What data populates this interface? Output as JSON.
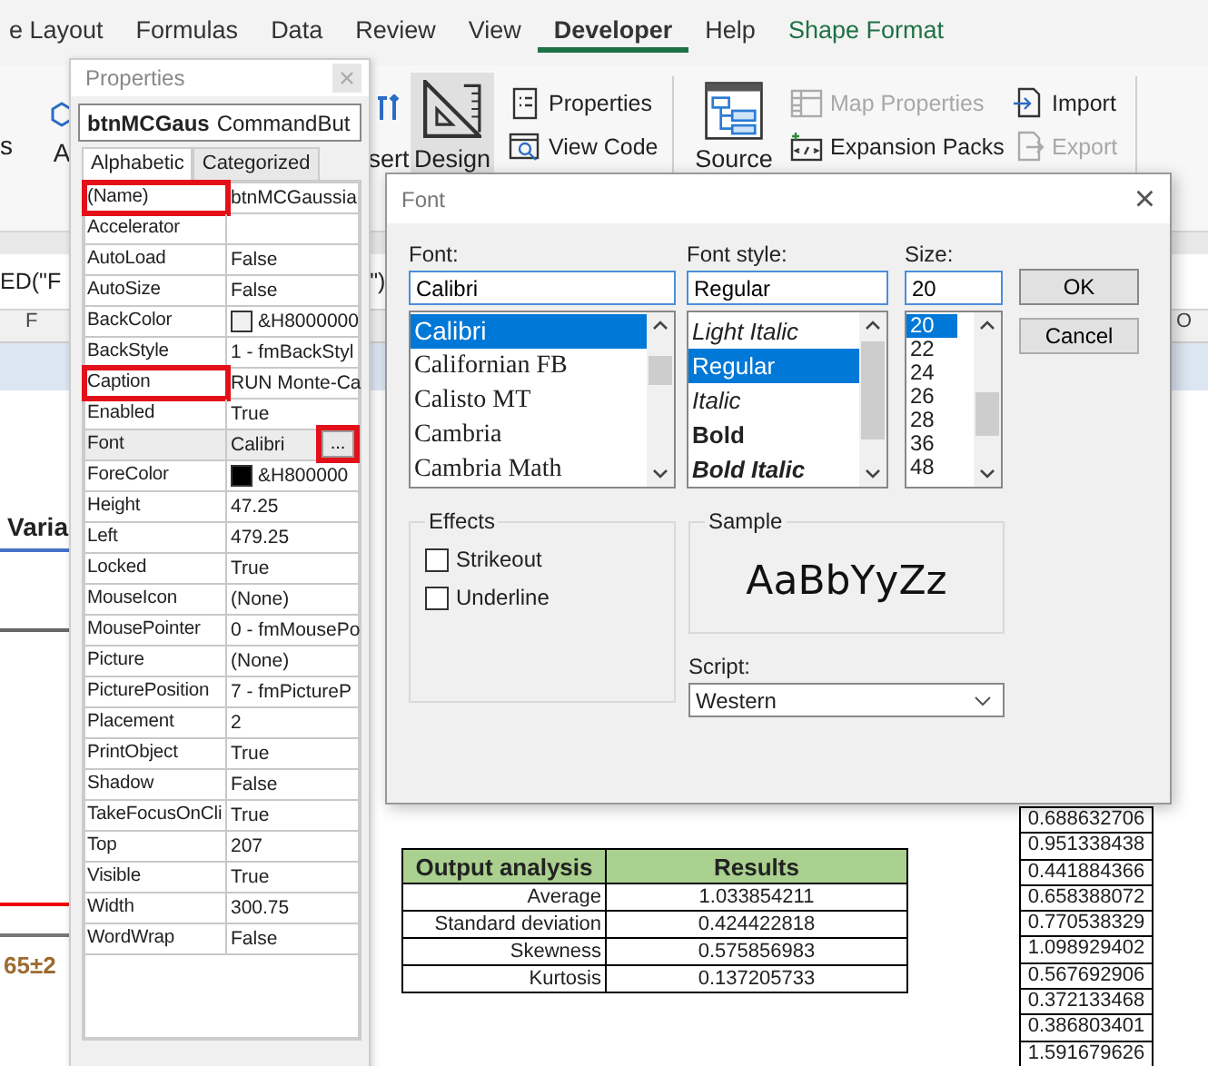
{
  "ribbon": {
    "tabs": [
      {
        "label": "e Layout",
        "selected": false,
        "kind": "normal"
      },
      {
        "label": "Formulas",
        "selected": false,
        "kind": "normal"
      },
      {
        "label": "Data",
        "selected": false,
        "kind": "normal"
      },
      {
        "label": "Review",
        "selected": false,
        "kind": "normal"
      },
      {
        "label": "View",
        "selected": false,
        "kind": "normal"
      },
      {
        "label": "Developer",
        "selected": true,
        "kind": "normal"
      },
      {
        "label": "Help",
        "selected": false,
        "kind": "normal"
      },
      {
        "label": "Shape Format",
        "selected": false,
        "kind": "contextual"
      }
    ],
    "edge_text": "s",
    "addins_text": "A",
    "groups": [
      {
        "large": [
          {
            "label": "sert",
            "kind": "insert",
            "selected": false
          },
          {
            "label": "Design",
            "kind": "design",
            "selected": true
          }
        ],
        "columns": [
          [
            {
              "label": "Properties",
              "kind": "properties",
              "disabled": false
            },
            {
              "label": "View Code",
              "kind": "view-code",
              "disabled": false
            }
          ]
        ]
      },
      {
        "large": [
          {
            "label": "Source",
            "kind": "source",
            "selected": false
          }
        ],
        "columns": [
          [
            {
              "label": "Map Properties",
              "kind": "map",
              "disabled": true
            },
            {
              "label": "Expansion Packs",
              "kind": "packs",
              "disabled": false
            }
          ],
          [
            {
              "label": "Import",
              "kind": "import",
              "disabled": false
            },
            {
              "label": "Export",
              "kind": "export",
              "disabled": true
            }
          ]
        ]
      }
    ]
  },
  "formula_bar": {
    "left": "ED(\"F",
    "right": "\")"
  },
  "column_headers": [
    "F",
    "O"
  ],
  "sheet": {
    "heading": "Varia",
    "note": "65±2",
    "output_table": {
      "columns": [
        "Output analysis",
        "Results"
      ],
      "rows": [
        {
          "label": "Average",
          "value": "1.033854211"
        },
        {
          "label": "Standard deviation",
          "value": "0.424422818"
        },
        {
          "label": "Skewness",
          "value": "0.575856983"
        },
        {
          "label": "Kurtosis",
          "value": "0.137205733"
        }
      ]
    },
    "values": [
      "0.688632706",
      "0.951338438",
      "0.441884366",
      "0.658388072",
      "0.770538329",
      "1.098929402",
      "0.567692906",
      "0.372133468",
      "0.386803401",
      "1.591679626"
    ]
  },
  "properties": {
    "title": "Properties",
    "object_name": "btnMCGaus",
    "object_type": "CommandBut",
    "tabs": [
      {
        "label": "Alphabetic",
        "selected": true
      },
      {
        "label": "Categorized",
        "selected": false
      }
    ],
    "rows": [
      {
        "name": "(Name)",
        "value": "btnMCGaussia",
        "selected": false,
        "annotated": true
      },
      {
        "name": "Accelerator",
        "selected": false,
        "annotated": false
      },
      {
        "name": "AutoLoad",
        "value": "False",
        "selected": false,
        "annotated": false
      },
      {
        "name": "AutoSize",
        "value": "False",
        "selected": false,
        "annotated": false
      },
      {
        "name": "BackColor",
        "value": "&H8000000",
        "color": "#f0f0f0",
        "selected": false,
        "annotated": false
      },
      {
        "name": "BackStyle",
        "value": "1 - fmBackStyl",
        "selected": false,
        "annotated": false
      },
      {
        "name": "Caption",
        "value": "RUN Monte-Ca",
        "selected": false,
        "annotated": true
      },
      {
        "name": "Enabled",
        "value": "True",
        "selected": false,
        "annotated": false
      },
      {
        "name": "Font",
        "value": "Calibri",
        "button": "...",
        "selected": true,
        "annotated": false,
        "button_annotated": true
      },
      {
        "name": "ForeColor",
        "value": "&H800000",
        "color": "#000000",
        "selected": false,
        "annotated": false
      },
      {
        "name": "Height",
        "value": "47.25",
        "selected": false,
        "annotated": false
      },
      {
        "name": "Left",
        "value": "479.25",
        "selected": false,
        "annotated": false
      },
      {
        "name": "Locked",
        "value": "True",
        "selected": false,
        "annotated": false
      },
      {
        "name": "MouseIcon",
        "value": "(None)",
        "selected": false,
        "annotated": false
      },
      {
        "name": "MousePointer",
        "value": "0 - fmMousePo",
        "selected": false,
        "annotated": false
      },
      {
        "name": "Picture",
        "value": "(None)",
        "selected": false,
        "annotated": false
      },
      {
        "name": "PicturePosition",
        "value": "7 - fmPictureP",
        "selected": false,
        "annotated": false
      },
      {
        "name": "Placement",
        "value": "2",
        "selected": false,
        "annotated": false
      },
      {
        "name": "PrintObject",
        "value": "True",
        "selected": false,
        "annotated": false
      },
      {
        "name": "Shadow",
        "value": "False",
        "selected": false,
        "annotated": false
      },
      {
        "name": "TakeFocusOnCli",
        "value": "True",
        "selected": false,
        "annotated": false
      },
      {
        "name": "Top",
        "value": "207",
        "selected": false,
        "annotated": false
      },
      {
        "name": "Visible",
        "value": "True",
        "selected": false,
        "annotated": false
      },
      {
        "name": "Width",
        "value": "300.75",
        "selected": false,
        "annotated": false
      },
      {
        "name": "WordWrap",
        "value": "False",
        "selected": false,
        "annotated": false
      }
    ]
  },
  "font_dialog": {
    "title": "Font",
    "close": "×",
    "font": {
      "label": "Font:",
      "value": "Calibri",
      "items": [
        {
          "label": "Calibri",
          "kind": "sans",
          "selected": true
        },
        {
          "label": "Californian FB",
          "kind": "serif",
          "selected": false
        },
        {
          "label": "Calisto MT",
          "kind": "serif",
          "selected": false
        },
        {
          "label": "Cambria",
          "kind": "serif",
          "selected": false
        },
        {
          "label": "Cambria Math",
          "kind": "serif",
          "selected": false
        }
      ]
    },
    "style": {
      "label": "Font style:",
      "value": "Regular",
      "items": [
        {
          "label": "Light Italic",
          "kind": "italic",
          "selected": false
        },
        {
          "label": "Regular",
          "kind": "regular",
          "selected": true
        },
        {
          "label": "Italic",
          "kind": "italic",
          "selected": false
        },
        {
          "label": "Bold",
          "kind": "bold",
          "selected": false
        },
        {
          "label": "Bold Italic",
          "kind": "bold-italic",
          "selected": false
        }
      ]
    },
    "size": {
      "label": "Size:",
      "value": "20",
      "items": [
        {
          "label": "20",
          "selected": true
        },
        {
          "label": "22",
          "selected": false
        },
        {
          "label": "24",
          "selected": false
        },
        {
          "label": "26",
          "selected": false
        },
        {
          "label": "28",
          "selected": false
        },
        {
          "label": "36",
          "selected": false
        },
        {
          "label": "48",
          "selected": false
        }
      ]
    },
    "buttons": [
      "OK",
      "Cancel"
    ],
    "effects": {
      "label": "Effects",
      "options": [
        {
          "label": "Strikeout",
          "checked": false
        },
        {
          "label": "Underline",
          "checked": false
        }
      ]
    },
    "sample": {
      "label": "Sample",
      "text": "AaBbYyZz"
    },
    "script": {
      "label": "Script:",
      "value": "Western"
    }
  }
}
